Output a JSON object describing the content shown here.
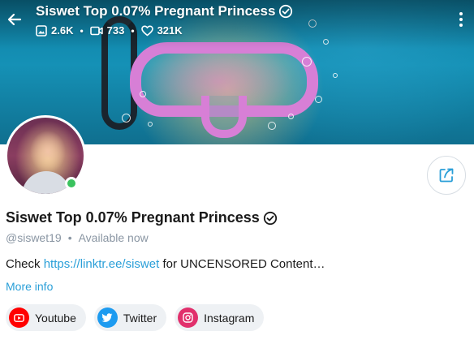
{
  "header": {
    "title": "Siswet Top 0.07% Pregnant Princess",
    "stats": {
      "photos": "2.6K",
      "videos": "733",
      "likes": "321K"
    }
  },
  "profile": {
    "name": "Siswet Top 0.07% Pregnant Princess",
    "username": "@siswet19",
    "status": "Available now",
    "bio_prefix": "Check",
    "bio_link": "https://linktr.ee/siswet",
    "bio_suffix": "for UNCENSORED Content…",
    "more_info": "More info",
    "online": true
  },
  "socials": [
    {
      "label": "Youtube",
      "icon": "youtube-icon",
      "color": "#ff0000"
    },
    {
      "label": "Twitter",
      "icon": "twitter-icon",
      "color": "#1d9bf0"
    },
    {
      "label": "Instagram",
      "icon": "instagram-icon",
      "color": "#e1306c"
    }
  ],
  "colors": {
    "accent": "#2a9fd8",
    "online": "#3ac25e",
    "muted": "#8a96a3"
  }
}
